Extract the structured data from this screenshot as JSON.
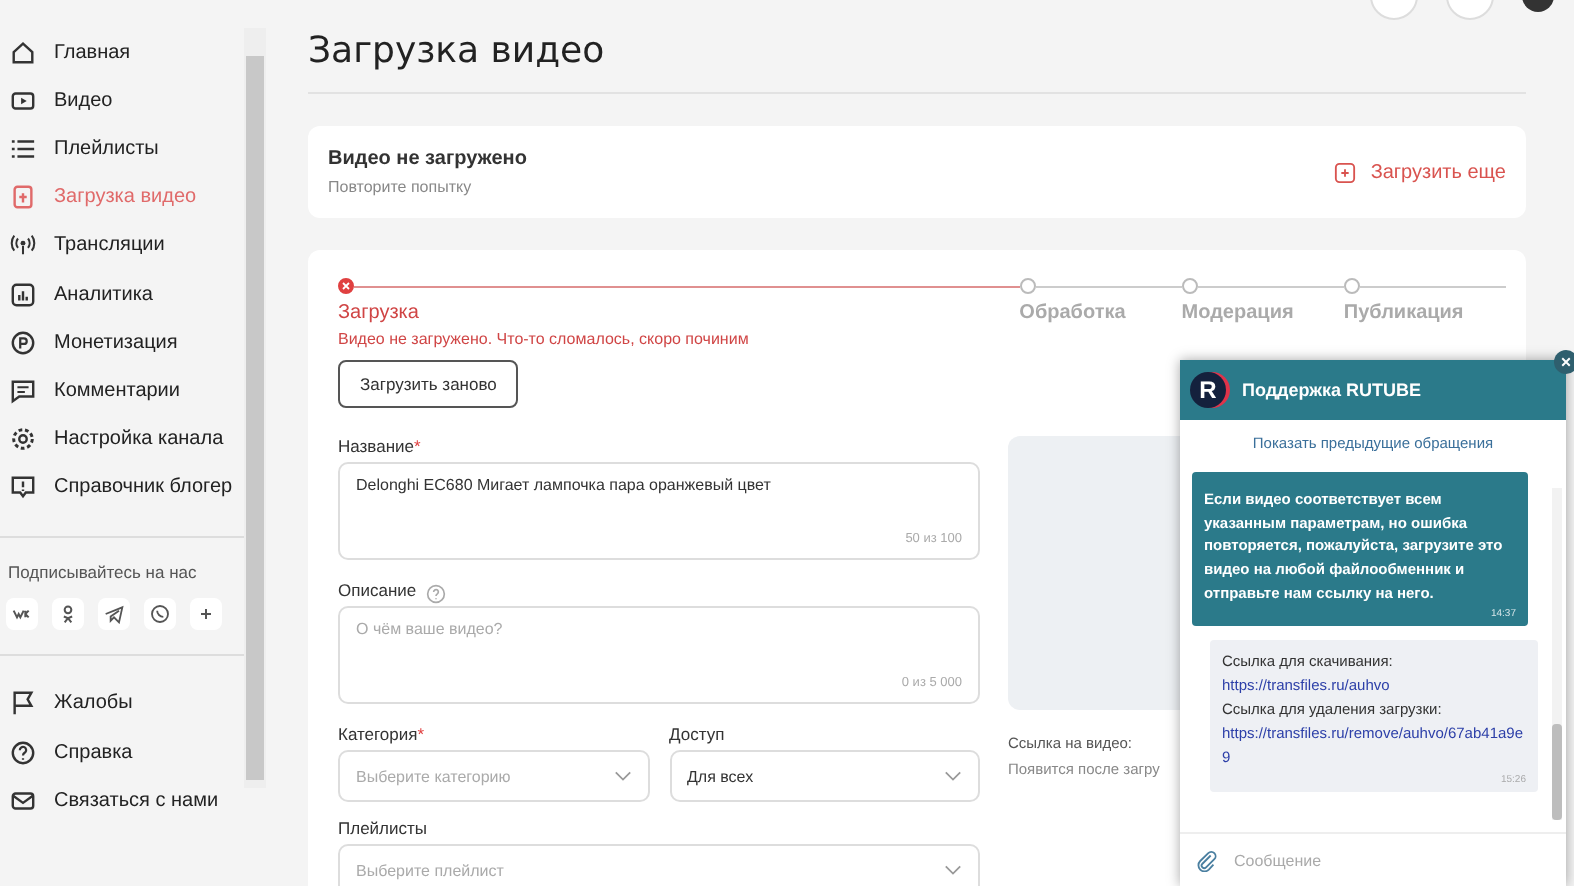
{
  "sidebar": {
    "items": [
      {
        "label": "Главная",
        "selected": false
      },
      {
        "label": "Видео",
        "selected": false
      },
      {
        "label": "Плейлисты",
        "selected": false
      },
      {
        "label": "Загрузка видео",
        "selected": true
      },
      {
        "label": "Трансляции",
        "selected": false
      },
      {
        "label": "Аналитика",
        "selected": false
      },
      {
        "label": "Монетизация",
        "selected": false
      },
      {
        "label": "Комментарии",
        "selected": false
      },
      {
        "label": "Настройка канала",
        "selected": false
      },
      {
        "label": "Справочник блогер",
        "selected": false
      }
    ],
    "social_title": "Подписывайтесь на нас",
    "bottom_items": [
      {
        "label": "Жалобы"
      },
      {
        "label": "Справка"
      },
      {
        "label": "Связаться с нами"
      }
    ]
  },
  "page_title": "Загрузка видео",
  "status_card": {
    "title": "Видео не загружено",
    "subtitle": "Повторите попытку",
    "action": "Загрузить еще"
  },
  "stepper": [
    {
      "label": "Загрузка",
      "error": true
    },
    {
      "label": "Обработка",
      "error": false
    },
    {
      "label": "Модерация",
      "error": false
    },
    {
      "label": "Публикация",
      "error": false
    }
  ],
  "error_message": "Видео не загружено. Что-то сломалось, скоро починим",
  "retry_button": "Загрузить заново",
  "form": {
    "title_field": {
      "label": "Название",
      "required_mark": "*",
      "value": "Delonghi EC680 Мигает лампочка пара оранжевый цвет",
      "counter": "50 из 100"
    },
    "description_field": {
      "label": "Описание",
      "placeholder": "О чём ваше видео?",
      "counter": "0 из 5 000"
    },
    "category": {
      "label": "Категория",
      "required_mark": "*",
      "placeholder": "Выберите категорию"
    },
    "access": {
      "label": "Доступ",
      "value": "Для всех"
    },
    "playlists": {
      "label": "Плейлисты",
      "placeholder": "Выберите плейлист"
    }
  },
  "video_link": {
    "label": "Ссылка на видео:",
    "value": "Появится после загру"
  },
  "chat": {
    "title": "Поддержка RUTUBE",
    "logo": "R",
    "history_link": "Показать предыдущие обращения",
    "messages": [
      {
        "kind": "support",
        "text": "Если видео соответствует всем указанным параметрам, но ошибка повторяется, пожалуйста, загрузите это видео на любой файлообменник и отправьте нам ссылку на него.",
        "time": "14:37"
      },
      {
        "kind": "user",
        "lines": [
          {
            "kind": "text",
            "text": "Ссылка для скачивания:"
          },
          {
            "kind": "link",
            "text": "https://transfiles.ru/auhvo"
          },
          {
            "kind": "text",
            "text": "Ссылка для удаления загрузки:"
          },
          {
            "kind": "link",
            "text": "https://transfiles.ru/remove/auhvo/67ab41a9e9"
          }
        ],
        "time": "15:26"
      }
    ],
    "input_placeholder": "Сообщение"
  }
}
